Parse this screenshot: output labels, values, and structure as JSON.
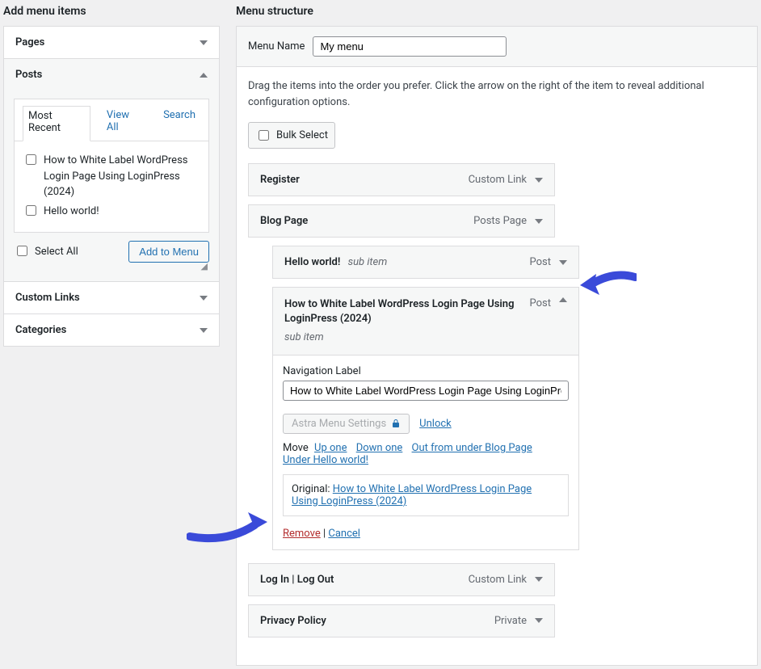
{
  "left": {
    "heading": "Add menu items",
    "pages_label": "Pages",
    "posts_label": "Posts",
    "custom_links_label": "Custom Links",
    "categories_label": "Categories",
    "tabs": {
      "recent": "Most Recent",
      "viewall": "View All",
      "search": "Search"
    },
    "post_items": [
      "How to White Label WordPress Login Page Using LoginPress (2024)",
      "Hello world!"
    ],
    "select_all": "Select All",
    "add_to_menu": "Add to Menu"
  },
  "right": {
    "heading": "Menu structure",
    "menu_name_label": "Menu Name",
    "menu_name_value": "My menu",
    "instructions": "Drag the items into the order you prefer. Click the arrow on the right of the item to reveal additional configuration options.",
    "bulk_select": "Bulk Select",
    "items": {
      "register": {
        "title": "Register",
        "type": "Custom Link"
      },
      "blog": {
        "title": "Blog Page",
        "type": "Posts Page"
      },
      "hello": {
        "title": "Hello world!",
        "sub": "sub item",
        "type": "Post"
      },
      "howto": {
        "title": "How to White Label WordPress Login Page Using LoginPress (2024)",
        "sub": "sub item",
        "type": "Post",
        "nav_label_label": "Navigation Label",
        "nav_label_value": "How to White Label WordPress Login Page Using LoginPress",
        "astra_label": "Astra Menu Settings",
        "unlock": "Unlock",
        "move_label": "Move",
        "move_up": "Up one",
        "move_down": "Down one",
        "move_out": "Out from under Blog Page",
        "move_under": "Under Hello world!",
        "original_label": "Original:",
        "original_link": "How to White Label WordPress Login Page Using LoginPress (2024)",
        "remove": "Remove",
        "cancel": "Cancel"
      },
      "login": {
        "title": "Log In | Log Out",
        "type": "Custom Link"
      },
      "privacy": {
        "title": "Privacy Policy",
        "type": "Private"
      }
    }
  },
  "colors": {
    "arrow": "#3a4ad9"
  }
}
